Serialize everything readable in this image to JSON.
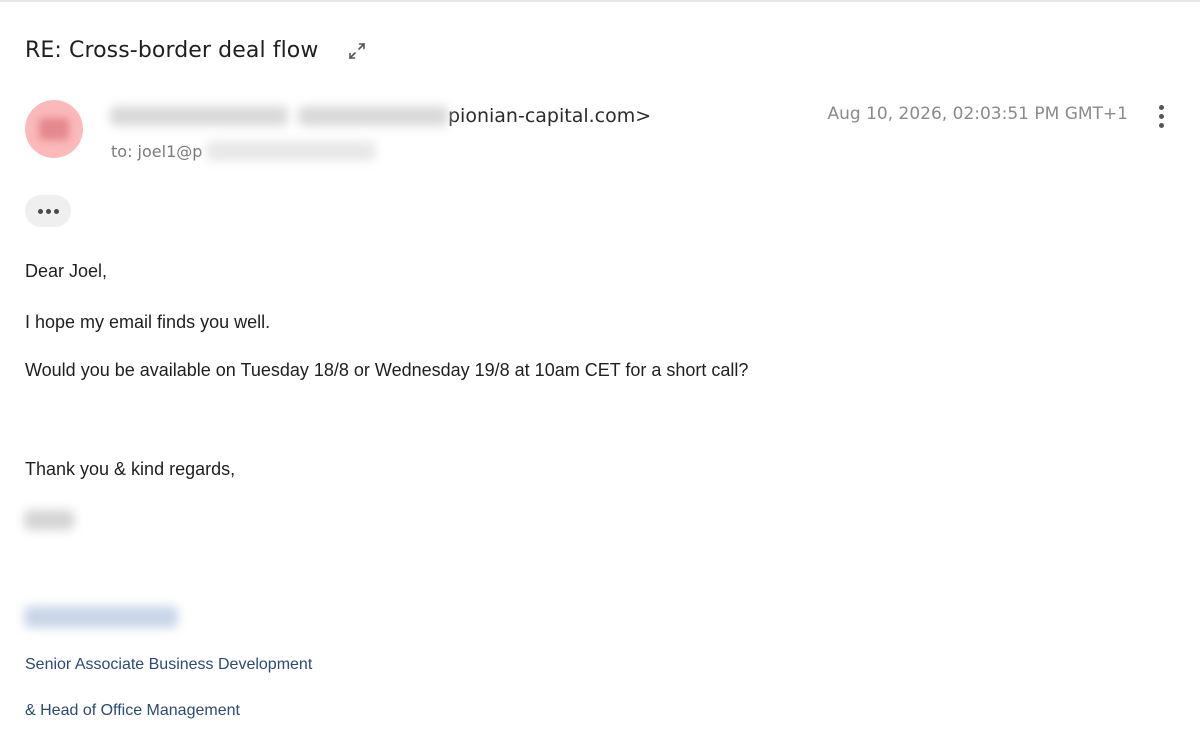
{
  "email": {
    "subject": "RE: Cross-border deal flow",
    "sender": {
      "address_visible": "pionian-capital.com>"
    },
    "to_label": "to: joel1@p",
    "timestamp": "Aug 10, 2026, 02:03:51 PM GMT+1",
    "body": {
      "greeting": "Dear Joel,",
      "line1": "I hope my email finds you well.",
      "line2": "Would you be available on Tuesday 18/8 or Wednesday 19/8 at 10am CET for a short call?",
      "closing": "Thank you & kind regards,"
    },
    "signature": {
      "title_line1": "Senior Associate Business Development",
      "title_line2": "& Head of Office Management"
    }
  },
  "icons": {
    "expand": "expand-arrows-icon",
    "more_actions": "vertical-dots-icon",
    "show_quoted": "horizontal-dots-icon"
  },
  "colors": {
    "avatar_bg": "#fbb9b9",
    "signature_text": "#2a4a7a",
    "muted_text": "#8a8a8a"
  }
}
